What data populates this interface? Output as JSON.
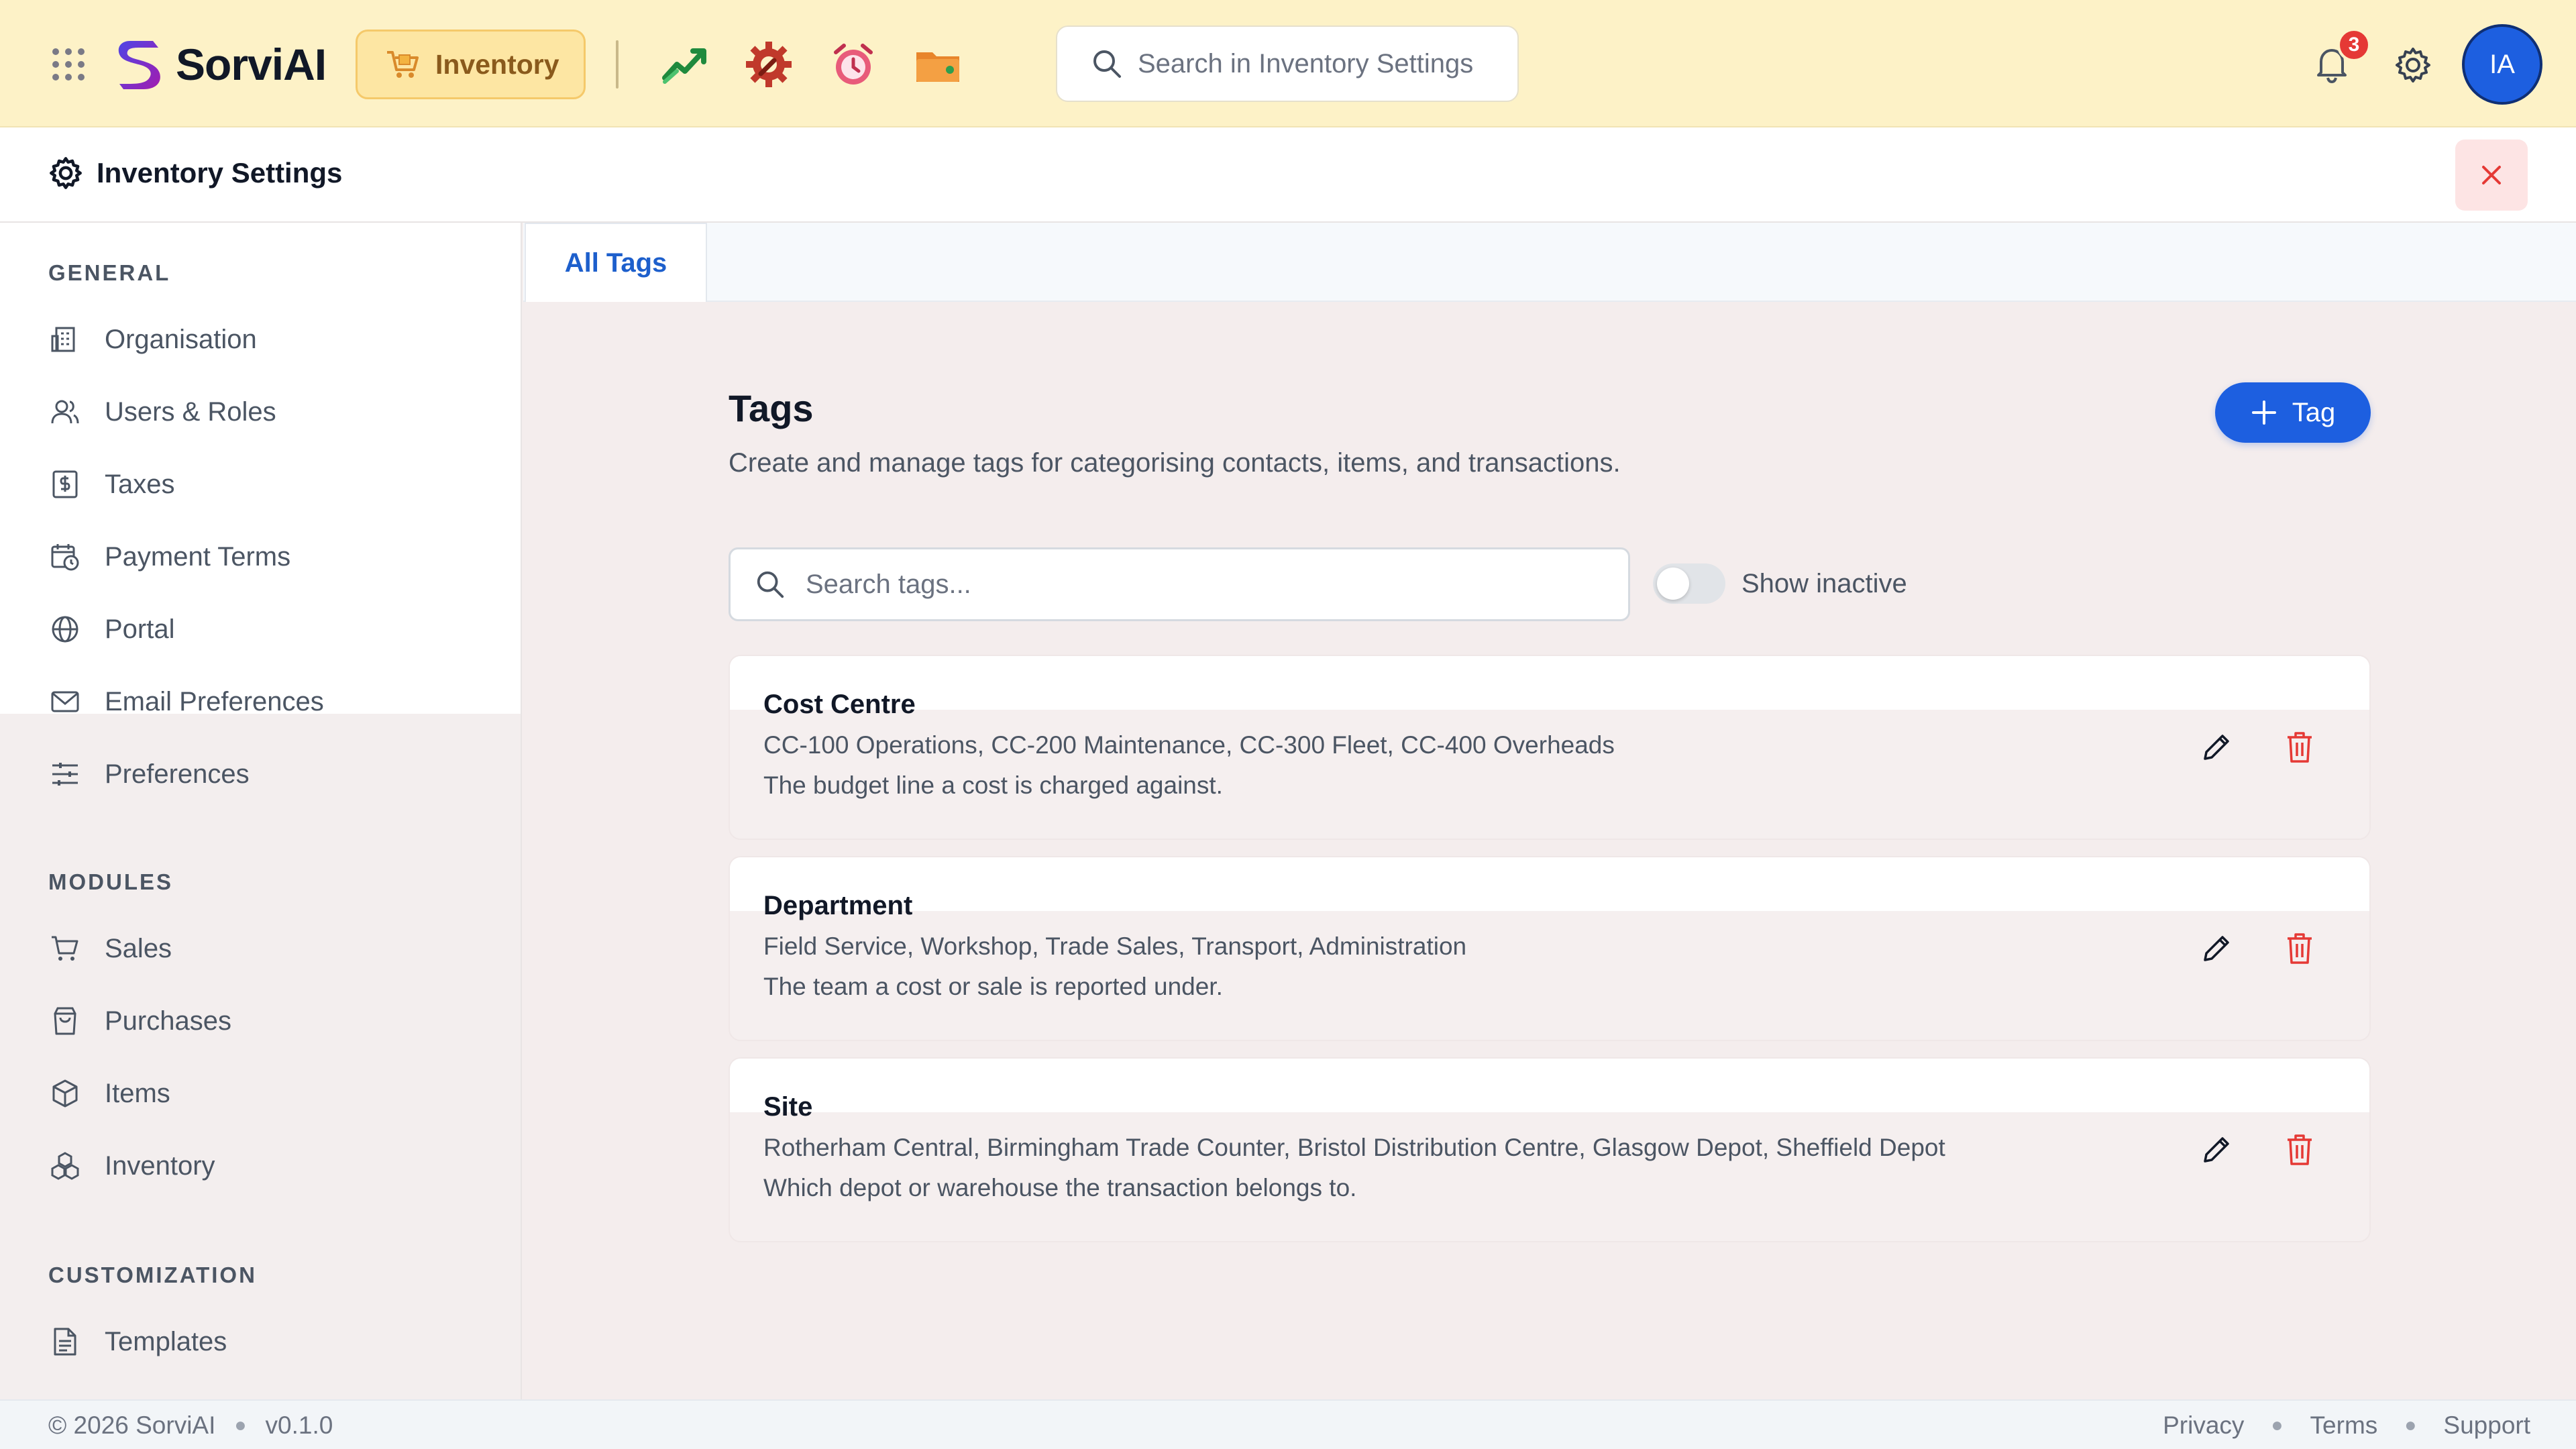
{
  "topbar": {
    "brand": "SorviAI",
    "module": "Inventory",
    "search_placeholder": "Search in Inventory Settings",
    "notification_count": "3",
    "avatar_initials": "IA",
    "quick_apps": [
      "chart-up-icon",
      "gear-wrench-icon",
      "alarm-clock-icon",
      "wallet-folder-icon"
    ]
  },
  "header": {
    "title": "Inventory Settings"
  },
  "sidebar": {
    "general_title": "GENERAL",
    "general": [
      {
        "label": "Organisation",
        "icon": "building-icon"
      },
      {
        "label": "Users & Roles",
        "icon": "users-icon"
      },
      {
        "label": "Taxes",
        "icon": "dollar-doc-icon"
      },
      {
        "label": "Payment Terms",
        "icon": "calendar-clock-icon"
      },
      {
        "label": "Portal",
        "icon": "globe-icon"
      },
      {
        "label": "Email Preferences",
        "icon": "mail-icon"
      },
      {
        "label": "Preferences",
        "icon": "sliders-icon"
      }
    ],
    "modules_title": "MODULES",
    "modules": [
      {
        "label": "Sales",
        "icon": "cart-icon"
      },
      {
        "label": "Purchases",
        "icon": "bag-icon"
      },
      {
        "label": "Items",
        "icon": "box-icon"
      },
      {
        "label": "Inventory",
        "icon": "boxes-icon"
      }
    ],
    "customization_title": "CUSTOMIZATION",
    "customization": [
      {
        "label": "Templates",
        "icon": "document-icon"
      }
    ]
  },
  "tabs": [
    {
      "label": "All Tags",
      "active": true
    }
  ],
  "main": {
    "title": "Tags",
    "subtitle": "Create and manage tags for categorising contacts, items, and transactions.",
    "add_button": "Tag",
    "search_placeholder": "Search tags...",
    "toggle_label": "Show inactive",
    "toggle_on": false,
    "tags": [
      {
        "name": "Cost Centre",
        "values": "CC-100 Operations, CC-200 Maintenance, CC-300 Fleet, CC-400 Overheads",
        "description": "The budget line a cost is charged against."
      },
      {
        "name": "Department",
        "values": "Field Service, Workshop, Trade Sales, Transport, Administration",
        "description": "The team a cost or sale is reported under."
      },
      {
        "name": "Site",
        "values": "Rotherham Central, Birmingham Trade Counter, Bristol Distribution Centre, Glasgow Depot, Sheffield Depot",
        "description": "Which depot or warehouse the transaction belongs to."
      }
    ]
  },
  "footer": {
    "copyright": "© 2026 SorviAI",
    "version": "v0.1.0",
    "links": [
      "Privacy",
      "Terms",
      "Support"
    ]
  },
  "colors": {
    "accent": "#1d5fe0",
    "topbar_bg": "#fdf2c7",
    "danger": "#e53935"
  }
}
